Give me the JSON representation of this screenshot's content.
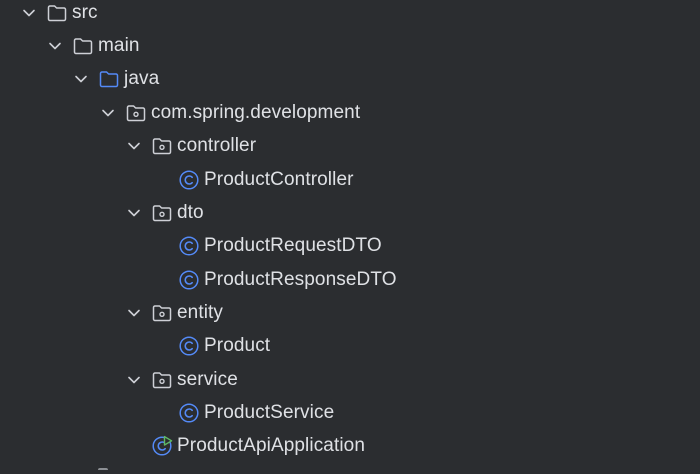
{
  "project_tree": {
    "items": [
      {
        "label": "src",
        "icon": "folder-icon",
        "expanded": true
      },
      {
        "label": "main",
        "icon": "folder-icon",
        "expanded": true
      },
      {
        "label": "java",
        "icon": "source-root-folder-icon",
        "expanded": true
      },
      {
        "label": "com.spring.development",
        "icon": "package-icon",
        "expanded": true
      },
      {
        "label": "controller",
        "icon": "package-icon",
        "expanded": true
      },
      {
        "label": "ProductController",
        "icon": "class-icon"
      },
      {
        "label": "dto",
        "icon": "package-icon",
        "expanded": true
      },
      {
        "label": "ProductRequestDTO",
        "icon": "class-icon"
      },
      {
        "label": "ProductResponseDTO",
        "icon": "class-icon"
      },
      {
        "label": "entity",
        "icon": "package-icon",
        "expanded": true
      },
      {
        "label": "Product",
        "icon": "class-icon"
      },
      {
        "label": "service",
        "icon": "package-icon",
        "expanded": true
      },
      {
        "label": "ProductService",
        "icon": "class-icon"
      },
      {
        "label": "ProductApiApplication",
        "icon": "spring-boot-application-icon"
      }
    ]
  },
  "colors": {
    "background": "#2b2d30",
    "text": "#dfe1e5",
    "icon_gray": "#ced0d6",
    "class_blue": "#548af7",
    "source_root_blue": "#548af7",
    "run_green": "#5fb865"
  }
}
